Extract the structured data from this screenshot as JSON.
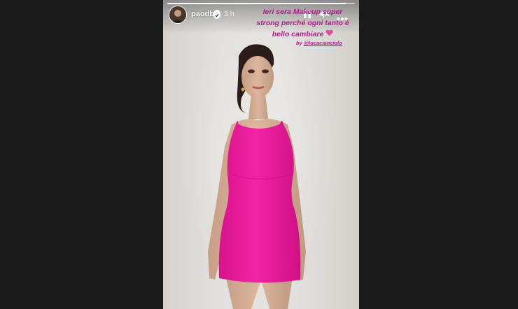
{
  "story": {
    "username": "paodb",
    "timestamp": "3 h",
    "progress": 0.95,
    "caption_lines": [
      "Ieri sera Makeup super",
      "strong perché ogni tanto è",
      "bello cambiare"
    ],
    "credit_prefix": "by ",
    "credit_handle": "@lucacianciolo"
  },
  "icons": {
    "verified": "verified-badge-icon",
    "pause": "pause-icon",
    "mute": "speaker-muted-icon",
    "more": "more-options-icon",
    "heart": "heart-sticker-icon"
  },
  "colors": {
    "background": "#1a1a1a",
    "dress": "#ec1b9c",
    "caption": "#b5198c"
  }
}
